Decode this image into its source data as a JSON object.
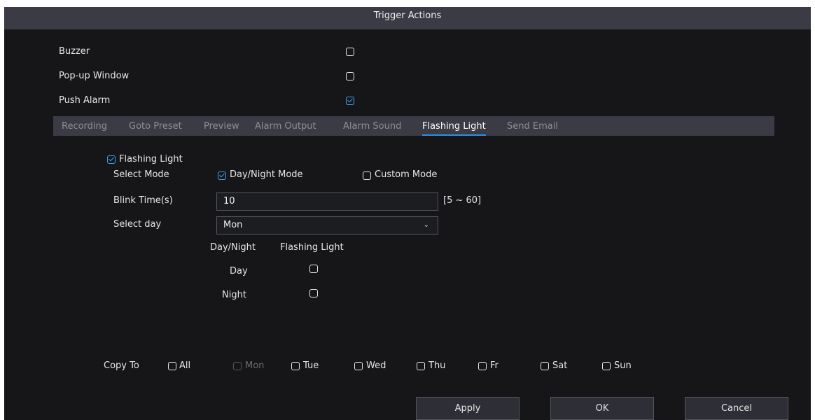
{
  "dialog": {
    "title": "Trigger Actions"
  },
  "options": [
    {
      "label": "Buzzer",
      "checked": false
    },
    {
      "label": "Pop-up Window",
      "checked": false
    },
    {
      "label": "Push Alarm",
      "checked": true
    }
  ],
  "tabs": [
    {
      "label": "Recording",
      "active": false
    },
    {
      "label": "Goto Preset",
      "active": false
    },
    {
      "label": "Preview",
      "active": false
    },
    {
      "label": "Alarm Output",
      "active": false
    },
    {
      "label": "Alarm Sound",
      "active": false
    },
    {
      "label": "Flashing Light",
      "active": true
    },
    {
      "label": "Send Email",
      "active": false
    }
  ],
  "flashing": {
    "enable_label": "Flashing Light",
    "enabled": true,
    "select_mode_label": "Select Mode",
    "mode_day_night": "Day/Night Mode",
    "mode_custom": "Custom Mode",
    "blink_time_label": "Blink Time(s)",
    "blink_time_value": "10",
    "blink_time_range": "[5 ~ 60]",
    "select_day_label": "Select day",
    "select_day_value": "Mon",
    "table": {
      "col_day_night": "Day/Night",
      "col_flashing": "Flashing Light",
      "rows": [
        {
          "label": "Day",
          "checked": false
        },
        {
          "label": "Night",
          "checked": false
        }
      ]
    }
  },
  "copy_to": {
    "label": "Copy To",
    "days": [
      "All",
      "Mon",
      "Tue",
      "Wed",
      "Thu",
      "Fr",
      "Sat",
      "Sun"
    ]
  },
  "buttons": {
    "apply": "Apply",
    "ok": "OK",
    "cancel": "Cancel"
  },
  "colors": {
    "accent": "#2e8ee6",
    "checkbox_checked": "#3fa0ef",
    "titlebar": "#3a3b44",
    "background": "#161619"
  }
}
